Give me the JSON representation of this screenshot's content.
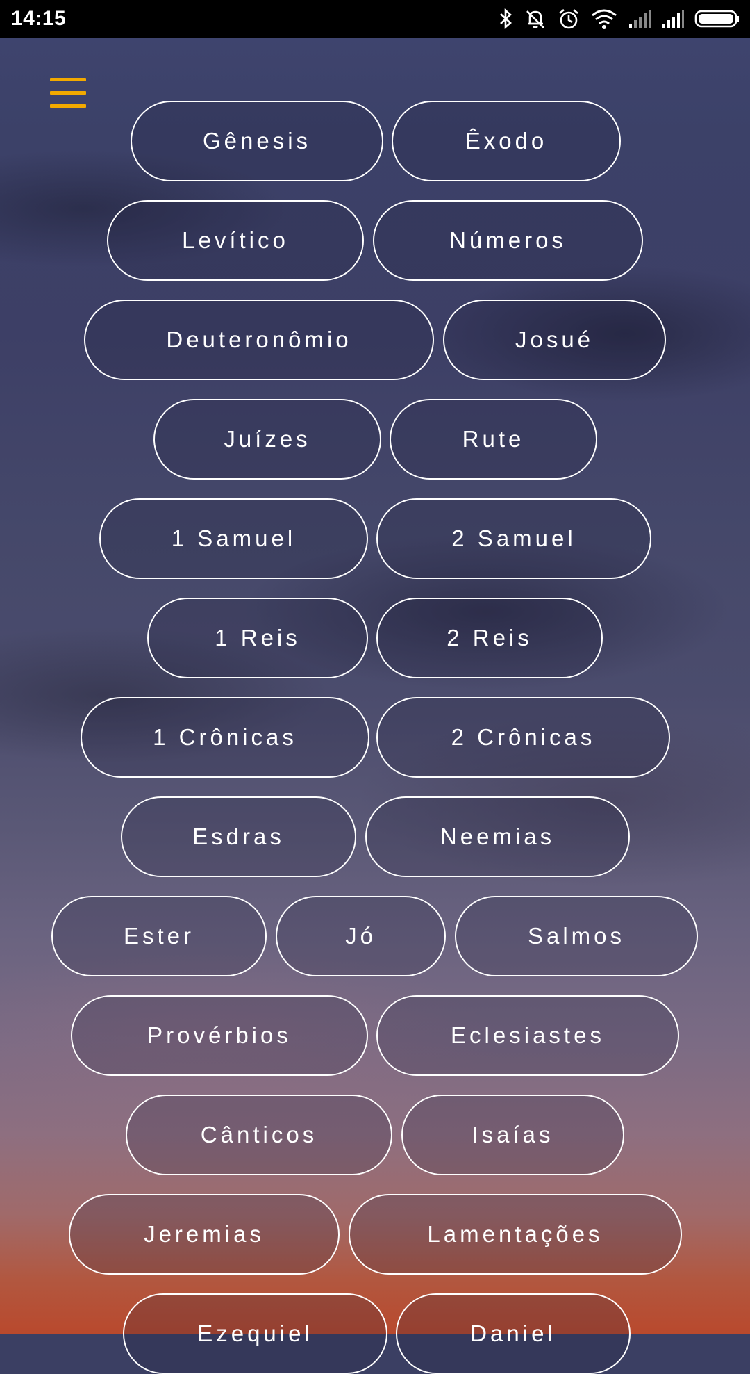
{
  "status_bar": {
    "time": "14:15",
    "icons": [
      "bluetooth-icon",
      "vibrate-off-icon",
      "alarm-icon",
      "wifi-icon",
      "signal-weak-icon",
      "signal-icon",
      "battery-icon"
    ]
  },
  "menu": {
    "icon": "hamburger-menu-icon",
    "color": "#f2a900"
  },
  "books": [
    "Gênesis",
    "Êxodo",
    "Levítico",
    "Números",
    "Deuteronômio",
    "Josué",
    "Juízes",
    "Rute",
    "1 Samuel",
    "2 Samuel",
    "1 Reis",
    "2 Reis",
    "1 Crônicas",
    "2 Crônicas",
    "Esdras",
    "Neemias",
    "Ester",
    "Jó",
    "Salmos",
    "Provérbios",
    "Eclesiastes",
    "Cânticos",
    "Isaías",
    "Jeremias",
    "Lamentações",
    "Ezequiel",
    "Daniel"
  ]
}
